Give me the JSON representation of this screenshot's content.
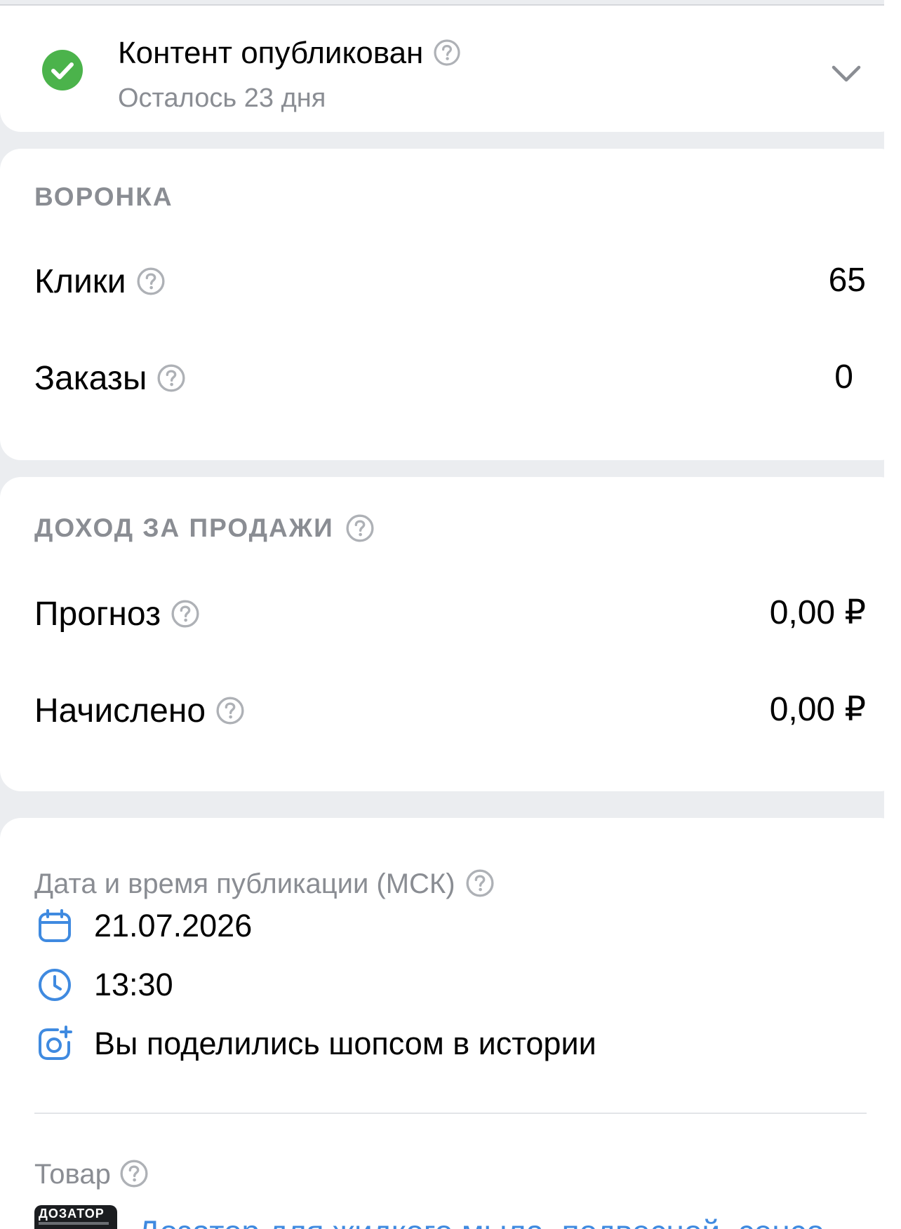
{
  "status": {
    "title": "Контент опубликован",
    "subtitle": "Осталось 23 дня",
    "colors": {
      "success": "#4bb34b"
    },
    "icons": {
      "status": "check-circle-icon",
      "help": "question-circle-icon",
      "expand": "chevron-down-icon"
    }
  },
  "funnel": {
    "title": "ВОРОНКА",
    "rows": [
      {
        "label": "Клики",
        "value": "65"
      },
      {
        "label": "Заказы",
        "value": "0"
      }
    ]
  },
  "income": {
    "title": "ДОХОД ЗА ПРОДАЖИ",
    "rows": [
      {
        "label": "Прогноз",
        "value": "0,00 ₽"
      },
      {
        "label": "Начислено",
        "value": "0,00 ₽"
      }
    ]
  },
  "publication": {
    "label": "Дата и время публикации (МСК)",
    "date": "21.07.2026",
    "time": "13:30",
    "shared_text": "Вы поделились шопсом в истории",
    "icons": {
      "date": "calendar-icon",
      "time": "clock-icon",
      "shared": "camera-add-icon"
    },
    "accent": "#3f8ae0"
  },
  "goods": {
    "label": "Товар",
    "thumb_text": "ДОЗАТОР",
    "link_text": "Дозатор для жидкого мыла, подвесной, сенсо"
  }
}
